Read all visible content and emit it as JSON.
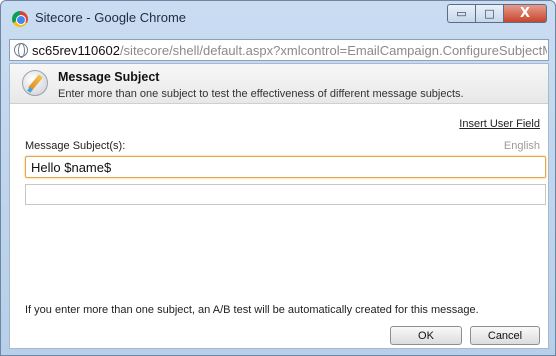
{
  "window": {
    "title": "Sitecore - Google Chrome",
    "minimize_glyph": "▭",
    "maximize_glyph": "□",
    "close_glyph": "X"
  },
  "address": {
    "host": "sc65rev110602",
    "path": "/sitecore/shell/default.aspx?xmlcontrol=EmailCampaign.ConfigureSubjectMVTest&"
  },
  "dialog": {
    "title": "Message Subject",
    "description": "Enter more than one subject to test the effectiveness of different message subjects.",
    "insert_user_field": "Insert User Field",
    "field_label": "Message Subject(s):",
    "language": "English",
    "subject_1_value": "Hello $name$",
    "subject_2_value": "",
    "info": "If you enter more than one subject, an A/B test will be automatically created for this message.",
    "ok_label": "OK",
    "cancel_label": "Cancel"
  },
  "icons": {
    "browser": "chrome-logo-icon",
    "address": "globe-icon",
    "header": "pen-edit-icon"
  }
}
